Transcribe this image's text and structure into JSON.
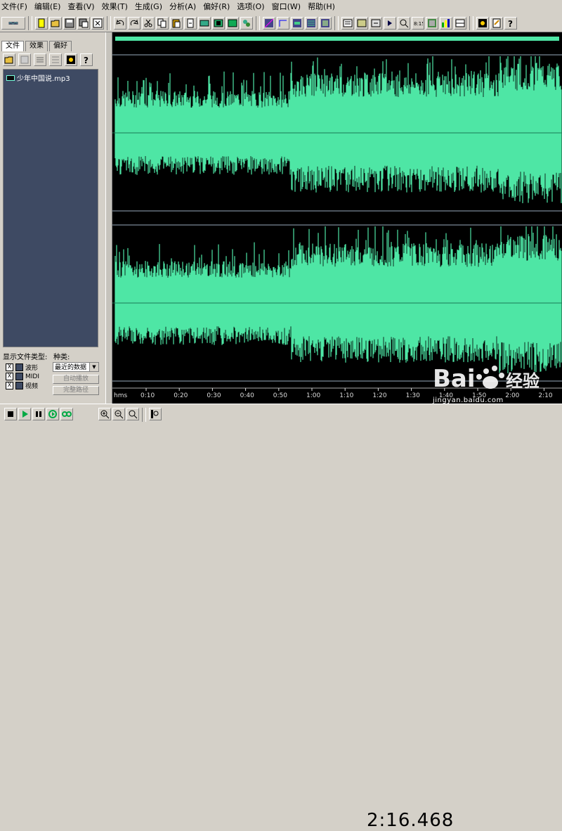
{
  "menu": [
    "文件(F)",
    "编辑(E)",
    "查看(V)",
    "效果(T)",
    "生成(G)",
    "分析(A)",
    "偏好(R)",
    "选项(O)",
    "窗口(W)",
    "帮助(H)"
  ],
  "left_panel": {
    "tabs": [
      "文件",
      "效果",
      "偏好"
    ],
    "active_tab": "文件",
    "files": [
      "少年中国说.mp3"
    ],
    "show_types_label": "显示文件类型:",
    "kind_label": "种类:",
    "types": [
      {
        "label": "波形",
        "checked": "X"
      },
      {
        "label": "MIDI",
        "checked": "X"
      },
      {
        "label": "视频",
        "checked": "X"
      }
    ],
    "kind_select": "最近的数据",
    "auto_play": "自动播放",
    "full_path": "完整路径"
  },
  "waveform": {
    "color": "#4ee6a5",
    "time_axis": [
      "hms",
      "0:10",
      "0:20",
      "0:30",
      "0:40",
      "0:50",
      "1:00",
      "1:10",
      "1:20",
      "1:30",
      "1:40",
      "1:50",
      "2:00",
      "2:10"
    ]
  },
  "status": {
    "time": "2:16.468"
  },
  "watermark": {
    "brand": "Bai",
    "brand2": "经验",
    "url": "jingyan.baidu.com"
  }
}
